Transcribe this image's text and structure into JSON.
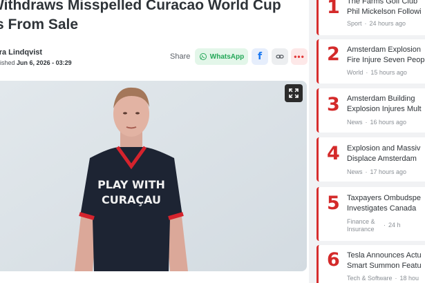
{
  "article": {
    "headline_line1": "Withdraws Misspelled Curacao World Cup",
    "headline_line2": "s From Sale",
    "author": "ora Lindqvist",
    "published_prefix": "ublished",
    "published_date": "Jun 6, 2026 - 03:29",
    "share_label": "Share",
    "whatsapp_label": "WhatsApp",
    "hero": {
      "shirt_line1": "PLAY WITH",
      "shirt_line2": "CURAÇAU"
    }
  },
  "colors": {
    "accent_red": "#d42a2a",
    "whatsapp_green": "#23a757",
    "facebook_blue": "#1877f2"
  },
  "icons": {
    "whatsapp": "whatsapp-icon",
    "facebook": "facebook-icon",
    "link": "link-icon",
    "more": "more-icon",
    "expand": "expand-icon"
  },
  "trending": [
    {
      "num": "1",
      "line1": "The Farms Golf Club",
      "line2": "Phil Mickelson Followi",
      "category": "Sport",
      "time": "24 hours ago"
    },
    {
      "num": "2",
      "line1": "Amsterdam Explosion",
      "line2": "Fire Injure Seven Peop",
      "category": "World",
      "time": "15 hours ago"
    },
    {
      "num": "3",
      "line1": "Amsterdam Building",
      "line2": "Explosion Injures Mult",
      "category": "News",
      "time": "16 hours ago"
    },
    {
      "num": "4",
      "line1": "Explosion and Massiv",
      "line2": "Displace Amsterdam",
      "category": "News",
      "time": "17 hours ago"
    },
    {
      "num": "5",
      "line1": "Taxpayers Ombudspe",
      "line2": "Investigates Canada",
      "category_line1": "Finance &",
      "category_line2": "Insurance",
      "time": "24 h"
    },
    {
      "num": "6",
      "line1": "Tesla Announces Actu",
      "line2": "Smart Summon Featu",
      "category": "Tech & Software",
      "time": "18 hou"
    }
  ]
}
